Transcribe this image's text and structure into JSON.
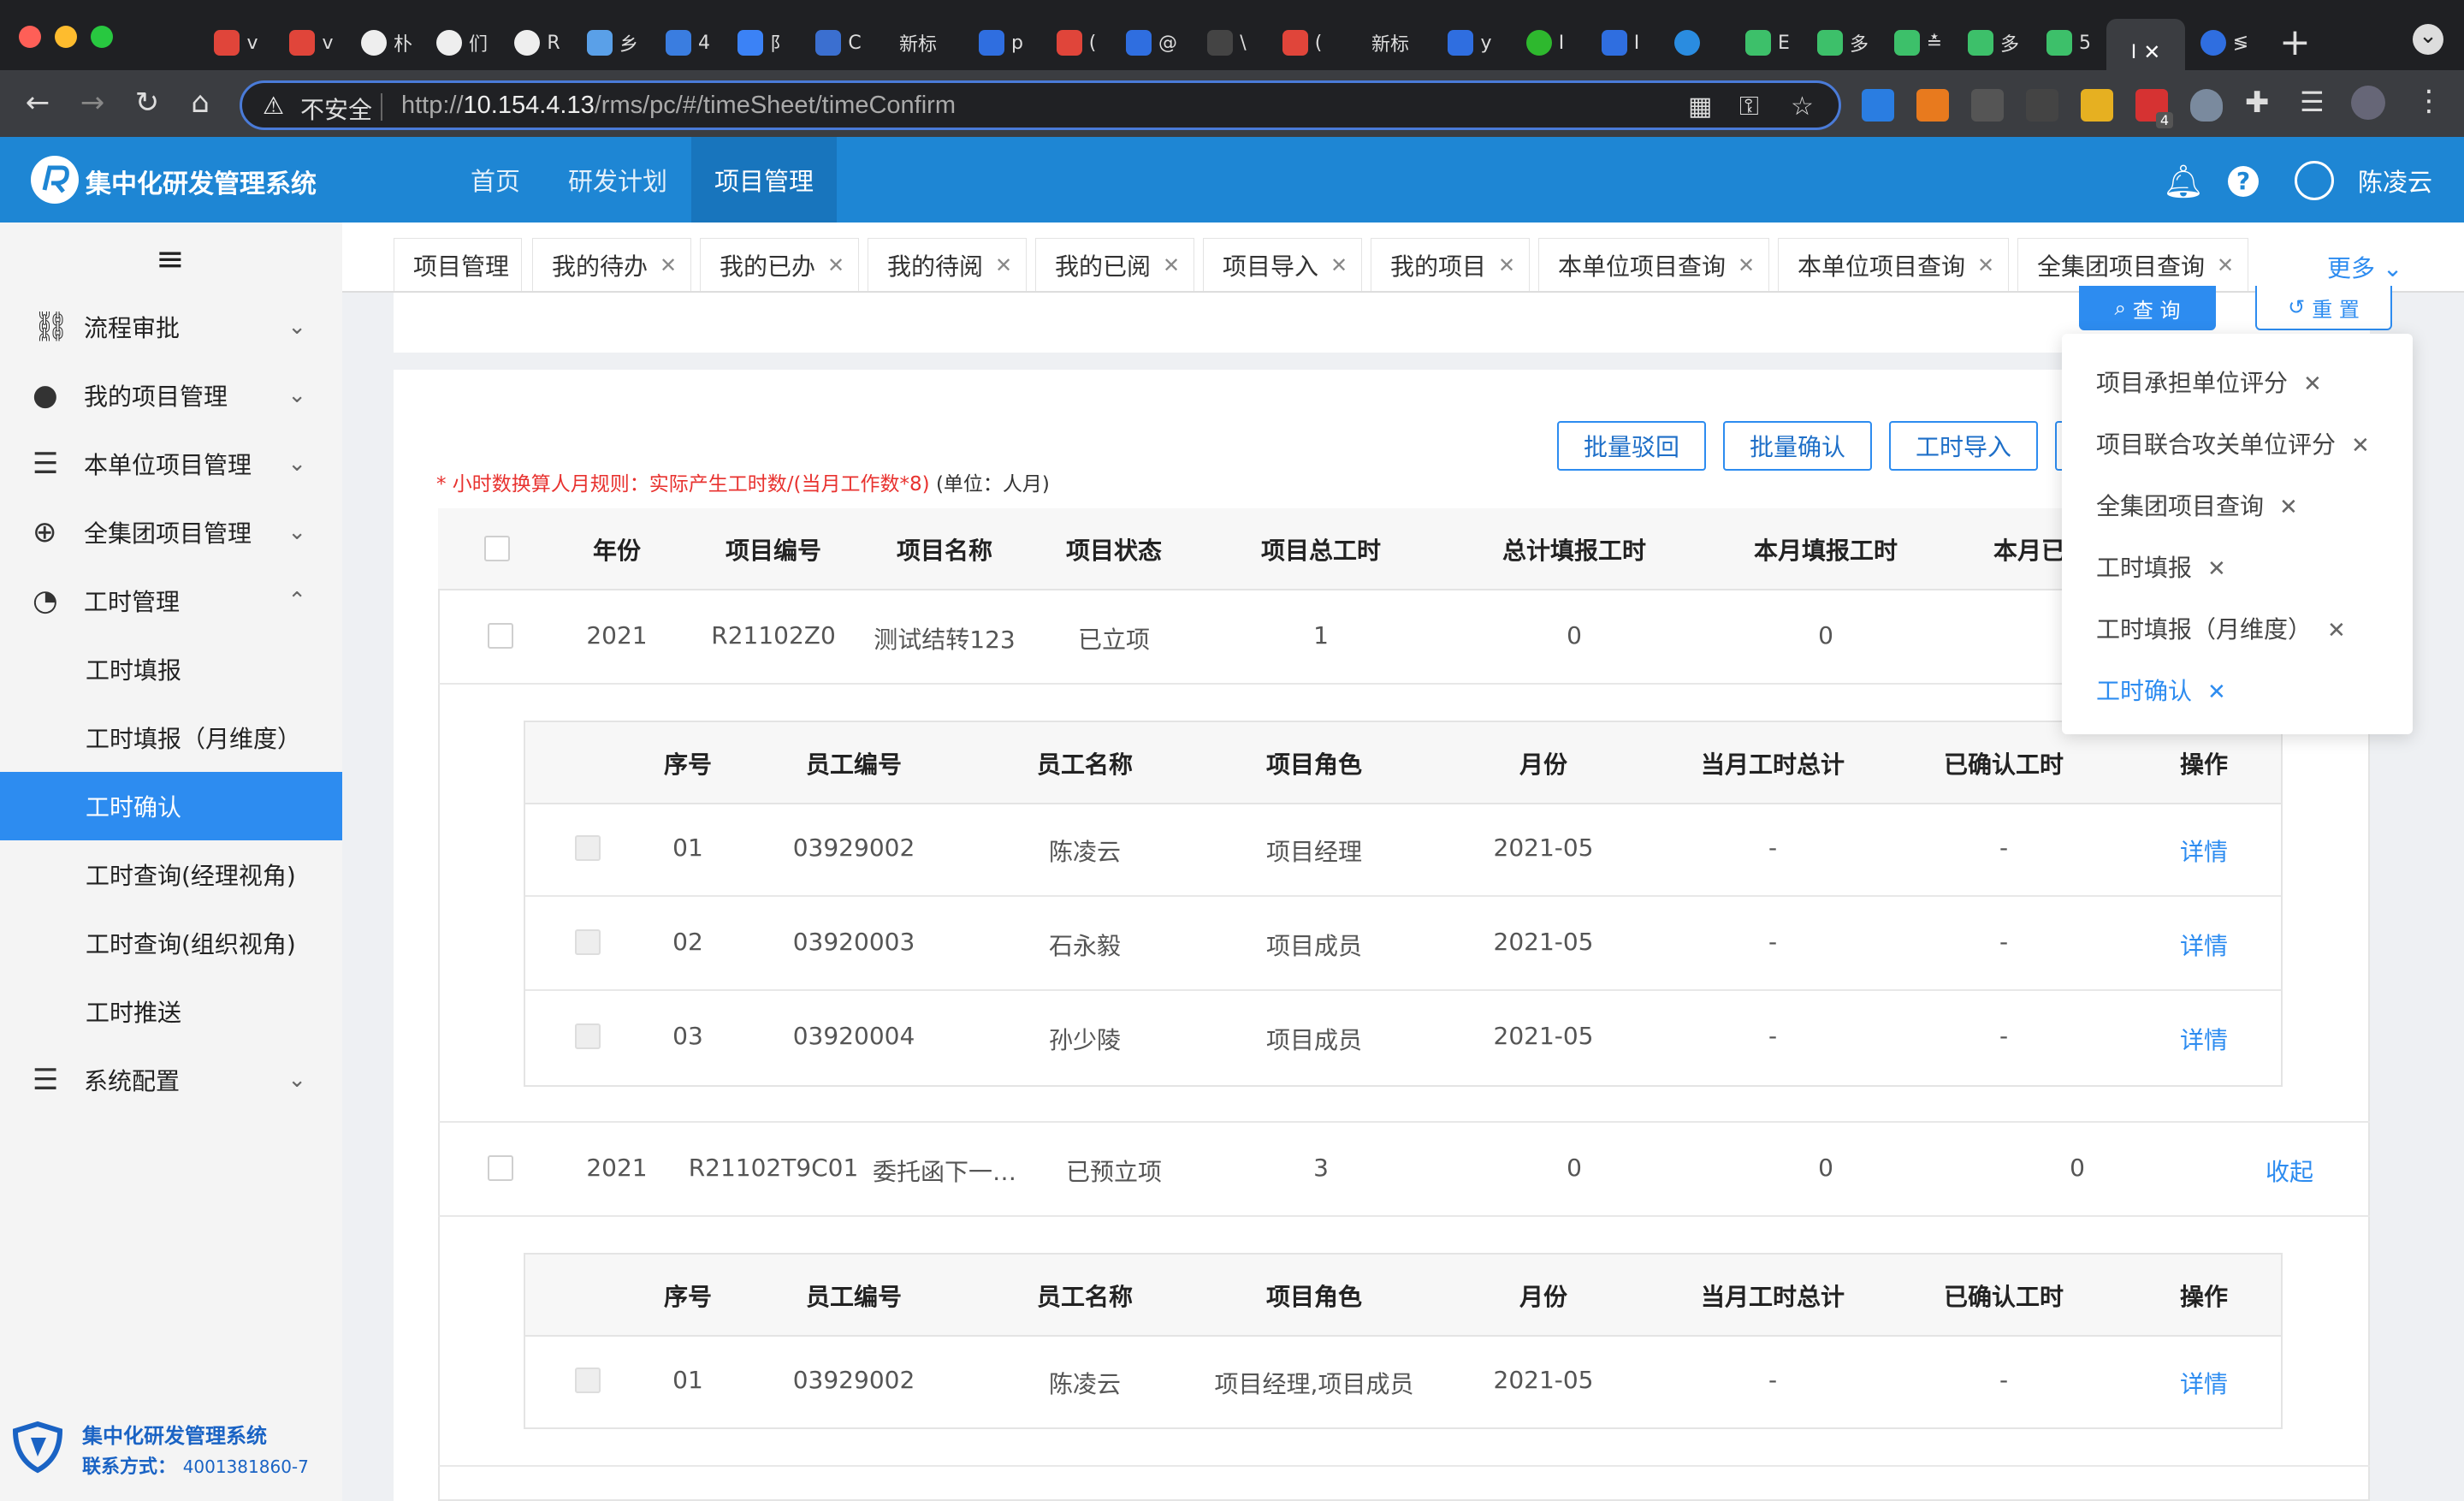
{
  "browser": {
    "tabs": [
      {
        "title": "v",
        "color": "#e0453a"
      },
      {
        "title": "v",
        "color": "#e0453a"
      },
      {
        "title": "朴",
        "color": "#eeeeee"
      },
      {
        "title": "们",
        "color": "#eeeeee"
      },
      {
        "title": "R",
        "color": "#eeeeee"
      },
      {
        "title": "乡",
        "color": "#5aa0e8"
      },
      {
        "title": "4",
        "color": "#3a7de0"
      },
      {
        "title": "阝",
        "color": "#3b82f6"
      },
      {
        "title": "C",
        "color": "#3b6fd0"
      },
      {
        "title": "新标",
        "color": ""
      },
      {
        "title": "p",
        "color": "#2f6ee0"
      },
      {
        "title": "(",
        "color": "#e0453a"
      },
      {
        "title": "@",
        "color": "#2f6ee0"
      },
      {
        "title": "\\",
        "color": "#444444"
      },
      {
        "title": "(",
        "color": "#e0453a"
      },
      {
        "title": "新标",
        "color": ""
      },
      {
        "title": "y",
        "color": "#2f6ee0"
      },
      {
        "title": "I",
        "color": "#2eb82e"
      },
      {
        "title": "I",
        "color": "#2f6ee0"
      },
      {
        "title": "",
        "color": "#2a8ce0"
      },
      {
        "title": "E",
        "color": "#3dc06a"
      },
      {
        "title": "多",
        "color": "#3dc06a"
      },
      {
        "title": "≛",
        "color": "#3dc06a"
      },
      {
        "title": "多",
        "color": "#3dc06a"
      },
      {
        "title": "5",
        "color": "#3dc06a"
      },
      {
        "title": "I",
        "color": "#3dc06a"
      }
    ],
    "active_tab_close": "✕",
    "tab_after_active": "≶",
    "new_tab": "+",
    "menu": "⌄",
    "security_label": "不安全",
    "url_prefix": "http://",
    "url_host": "10.154.4.13",
    "url_path": "/rms/pc/#/timeSheet/timeConfirm",
    "ext_badge": "4"
  },
  "header": {
    "app_name": "集中化研发管理系统",
    "nav": [
      {
        "label": "首页"
      },
      {
        "label": "研发计划"
      },
      {
        "label": "项目管理"
      }
    ],
    "user_name": "陈凌云"
  },
  "sidebar": {
    "menu_icon": "≡",
    "items": [
      {
        "label": "流程审批",
        "icon": "approval-icon",
        "glyph": "⛓"
      },
      {
        "label": "我的项目管理",
        "icon": "user-icon",
        "glyph": "👤"
      },
      {
        "label": "本单位项目管理",
        "icon": "layers-icon",
        "glyph": "☰"
      },
      {
        "label": "全集团项目管理",
        "icon": "globe-icon",
        "glyph": "🌐"
      },
      {
        "label": "工时管理",
        "icon": "clock-icon",
        "glyph": "◔"
      }
    ],
    "sub_items": [
      {
        "label": "工时填报"
      },
      {
        "label": "工时填报（月维度）"
      },
      {
        "label": "工时确认"
      },
      {
        "label": "工时查询(经理视角)"
      },
      {
        "label": "工时查询(组织视角)"
      },
      {
        "label": "工时推送"
      }
    ],
    "config_item": {
      "label": "系统配置",
      "icon": "settings-bars-icon",
      "glyph": "☰"
    },
    "footer_title": "集中化研发管理系统",
    "footer_contact_label": "联系方式：",
    "footer_contact_value": "4001381860-7"
  },
  "page_tabs": [
    {
      "label": "项目管理"
    },
    {
      "label": "我的待办"
    },
    {
      "label": "我的已办"
    },
    {
      "label": "我的待阅"
    },
    {
      "label": "我的已阅"
    },
    {
      "label": "项目导入"
    },
    {
      "label": "我的项目"
    },
    {
      "label": "本单位项目查询"
    },
    {
      "label": "本单位项目查询"
    },
    {
      "label": "全集团项目查询"
    }
  ],
  "more_label": "更多",
  "query_label": "查 询",
  "reset_label": "重 置",
  "actions": {
    "batch_reject": "批量驳回",
    "batch_confirm": "批量确认",
    "import": "工时导入"
  },
  "rule_note": "* 小时数换算人月规则：实际产生工时数/(当月工作数*8)",
  "rule_unit": "(单位：人月)",
  "table": {
    "headers": [
      "年份",
      "项目编号",
      "项目名称",
      "项目状态",
      "项目总工时",
      "总计填报工时",
      "本月填报工时",
      "本月已"
    ],
    "rows": [
      {
        "year": "2021",
        "code": "R21102Z0",
        "name": "测试结转123",
        "status": "已立项",
        "total": "1",
        "reported": "0",
        "month": "0",
        "confirmed": "",
        "action": ""
      },
      {
        "year": "2021",
        "code": "R21102T9C01",
        "name": "委托函下一…",
        "status": "已预立项",
        "total": "3",
        "reported": "0",
        "month": "0",
        "confirmed": "0",
        "action": "收起"
      }
    ]
  },
  "sub_table": {
    "headers": [
      "序号",
      "员工编号",
      "员工名称",
      "项目角色",
      "月份",
      "当月工时总计",
      "已确认工时",
      "操作"
    ],
    "groups": [
      [
        {
          "no": "01",
          "emp": "03929002",
          "name": "陈凌云",
          "role": "项目经理",
          "month": "2021-05",
          "total": "-",
          "confirmed": "-",
          "action": "详情"
        },
        {
          "no": "02",
          "emp": "03920003",
          "name": "石永毅",
          "role": "项目成员",
          "month": "2021-05",
          "total": "-",
          "confirmed": "-",
          "action": "详情"
        },
        {
          "no": "03",
          "emp": "03920004",
          "name": "孙少陵",
          "role": "项目成员",
          "month": "2021-05",
          "total": "-",
          "confirmed": "-",
          "action": "详情"
        }
      ],
      [
        {
          "no": "01",
          "emp": "03929002",
          "name": "陈凌云",
          "role": "项目经理,项目成员",
          "month": "2021-05",
          "total": "-",
          "confirmed": "-",
          "action": "详情"
        }
      ]
    ]
  },
  "dropdown": [
    {
      "label": "项目承担单位评分"
    },
    {
      "label": "项目联合攻关单位评分"
    },
    {
      "label": "全集团项目查询"
    },
    {
      "label": "工时填报"
    },
    {
      "label": "工时填报（月维度）"
    },
    {
      "label": "工时确认",
      "active": true
    }
  ],
  "colors": {
    "primary": "#2d8cf0",
    "header": "#1e86d4",
    "danger": "#e8322f"
  }
}
